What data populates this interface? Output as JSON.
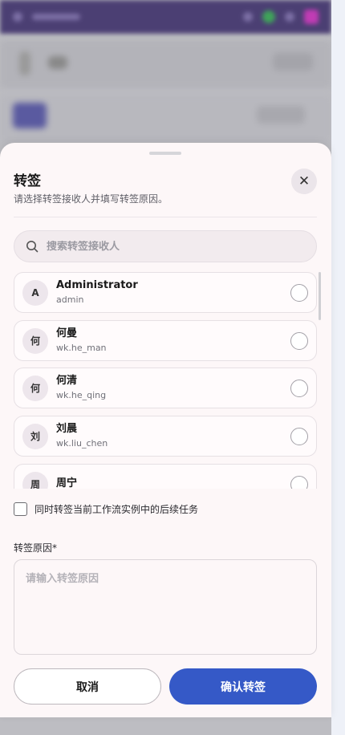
{
  "dialog": {
    "title": "转签",
    "subtitle": "请选择转签接收人并填写转签原因。",
    "close_label": "✕"
  },
  "search": {
    "placeholder": "搜索转签接收人"
  },
  "recipients": [
    {
      "initial": "A",
      "name": "Administrator",
      "username": "admin"
    },
    {
      "initial": "何",
      "name": "何曼",
      "username": "wk.he_man"
    },
    {
      "initial": "何",
      "name": "何清",
      "username": "wk.he_qing"
    },
    {
      "initial": "刘",
      "name": "刘晨",
      "username": "wk.liu_chen"
    },
    {
      "initial": "周",
      "name": "周宁",
      "username": ""
    }
  ],
  "options": {
    "transfer_subsequent_label": "同时转签当前工作流实例中的后续任务"
  },
  "reason": {
    "label": "转签原因*",
    "placeholder": "请输入转签原因"
  },
  "buttons": {
    "cancel": "取消",
    "confirm": "确认转签"
  },
  "colors": {
    "primary": "#3559c7",
    "topbar": "#4b3f73"
  }
}
